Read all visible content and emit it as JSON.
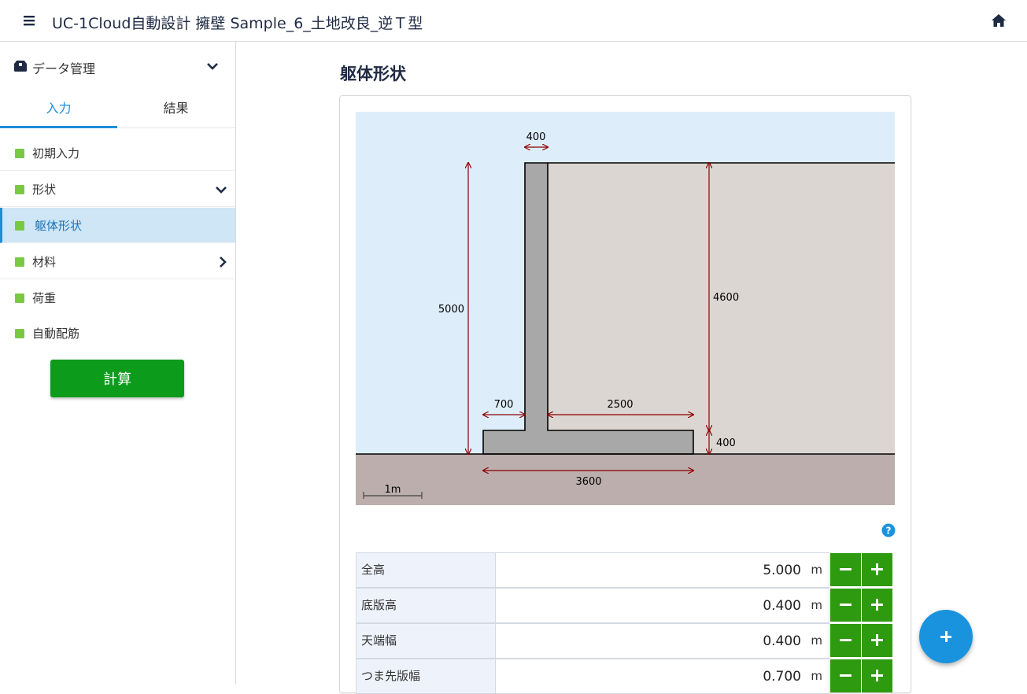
{
  "header": {
    "title": "UC-1Cloud自動設計 擁壁  Sample_6_土地改良_逆Ｔ型"
  },
  "sidebar": {
    "data_management_label": "データ管理",
    "tabs": [
      {
        "label": "入力",
        "active": true
      },
      {
        "label": "結果",
        "active": false
      }
    ],
    "items": [
      {
        "label": "初期入力"
      },
      {
        "label": "形状"
      },
      {
        "label": "躯体形状"
      },
      {
        "label": "材料"
      },
      {
        "label": "荷重"
      },
      {
        "label": "自動配筋"
      }
    ],
    "calc_button_label": "計算"
  },
  "main": {
    "section_title": "躯体形状",
    "diagram": {
      "dim_top_width": "400",
      "dim_total_height": "5000",
      "dim_stem_height": "4600",
      "dim_toe": "700",
      "dim_heel": "2500",
      "dim_base_thickness": "400",
      "dim_base_width": "3600",
      "scale_label": "1m"
    },
    "params": [
      {
        "name": "全高",
        "value": "5.000",
        "unit": "m"
      },
      {
        "name": "底版高",
        "value": "0.400",
        "unit": "m"
      },
      {
        "name": "天端幅",
        "value": "0.400",
        "unit": "m"
      },
      {
        "name": "つま先版幅",
        "value": "0.700",
        "unit": "m"
      }
    ]
  },
  "colors": {
    "accent": "#1d8fd8",
    "calc_button": "#0d9b1c",
    "stepper": "#2e9a0f",
    "sky": "#ddeefa",
    "backfill": "#dcd6d2",
    "ground": "#bbaeac",
    "concrete": "#a8a8a8",
    "dimension": "#8b0000"
  }
}
